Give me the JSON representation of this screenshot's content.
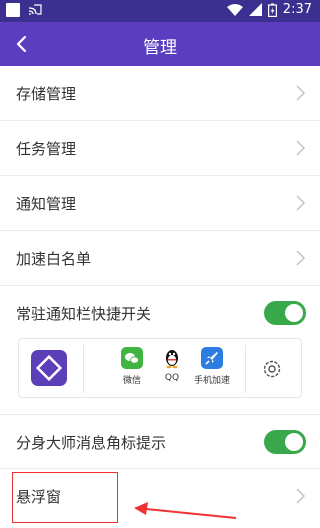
{
  "status_bar": {
    "time": "2:37"
  },
  "header": {
    "title": "管理"
  },
  "rows": [
    {
      "label": "存储管理"
    },
    {
      "label": "任务管理"
    },
    {
      "label": "通知管理"
    },
    {
      "label": "加速白名单"
    },
    {
      "label": "常驻通知栏快捷开关",
      "toggle_on": true
    },
    {
      "label": "分身大师消息角标提示",
      "toggle_on": true
    },
    {
      "label": "悬浮窗"
    }
  ],
  "quick_bar": {
    "items": [
      {
        "label": "微信",
        "icon": "wechat-icon"
      },
      {
        "label": "QQ",
        "icon": "qq-icon"
      },
      {
        "label": "手机加速",
        "icon": "rocket-icon"
      }
    ]
  },
  "colors": {
    "status_bar": "#3b2f8f",
    "app_bar": "#5b3ec0",
    "toggle_on": "#38a84a",
    "highlight": "#e33333"
  }
}
